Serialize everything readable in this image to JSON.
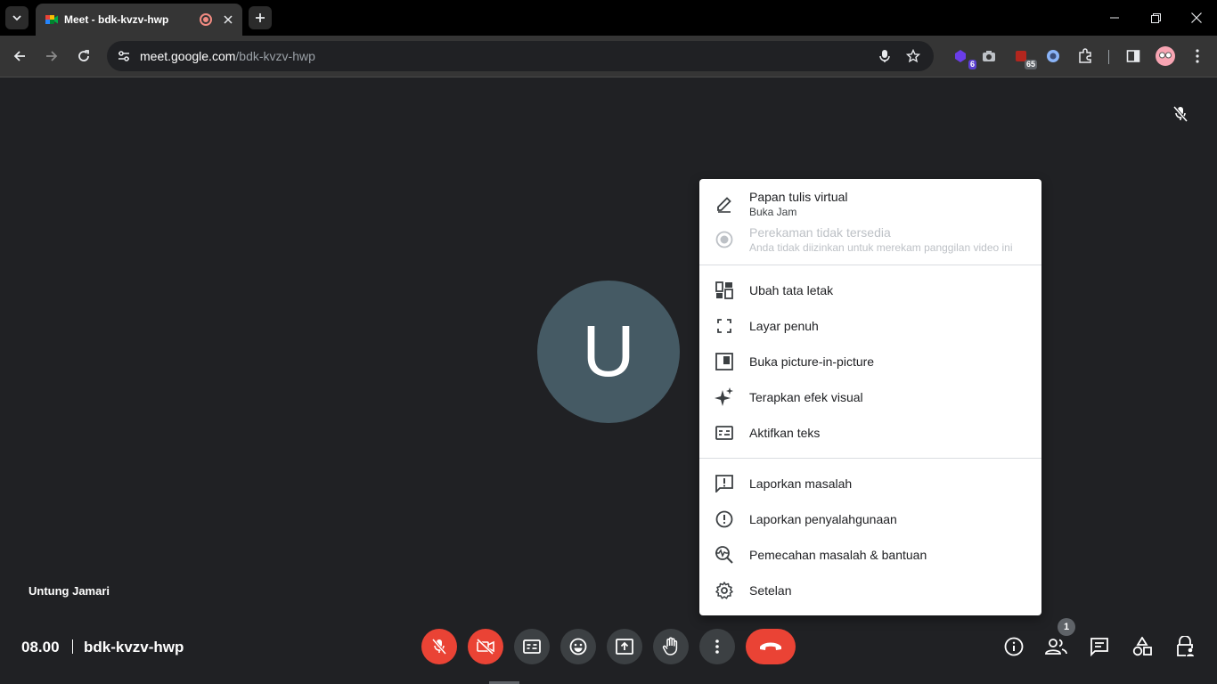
{
  "browser": {
    "tab_title": "Meet - bdk-kvzv-hwp",
    "url_host": "meet.google.com",
    "url_path": "/bdk-kvzv-hwp",
    "extensions": [
      {
        "name": "extension-purple",
        "badge": "6"
      },
      {
        "name": "extension-camera",
        "badge": ""
      },
      {
        "name": "extension-red",
        "badge": "65"
      },
      {
        "name": "extension-blue",
        "badge": ""
      }
    ]
  },
  "meet": {
    "avatar_initial": "U",
    "participant_name": "Untung Jamari",
    "time": "08.00",
    "meeting_code": "bdk-kvzv-hwp",
    "people_count": "1"
  },
  "menu": {
    "whiteboard": {
      "label": "Papan tulis virtual",
      "sub": "Buka Jam"
    },
    "recording": {
      "label": "Perekaman tidak tersedia",
      "sub": "Anda tidak diizinkan untuk merekam panggilan video ini"
    },
    "change_layout": "Ubah tata letak",
    "fullscreen": "Layar penuh",
    "pip": "Buka picture-in-picture",
    "visual_effects": "Terapkan efek visual",
    "captions": "Aktifkan teks",
    "report_problem": "Laporkan masalah",
    "report_abuse": "Laporkan penyalahgunaan",
    "troubleshooting": "Pemecahan masalah & bantuan",
    "settings": "Setelan"
  },
  "colors": {
    "accent_red": "#ea4335",
    "control_gray": "#3c4043",
    "avatar_bg": "#455a64"
  }
}
